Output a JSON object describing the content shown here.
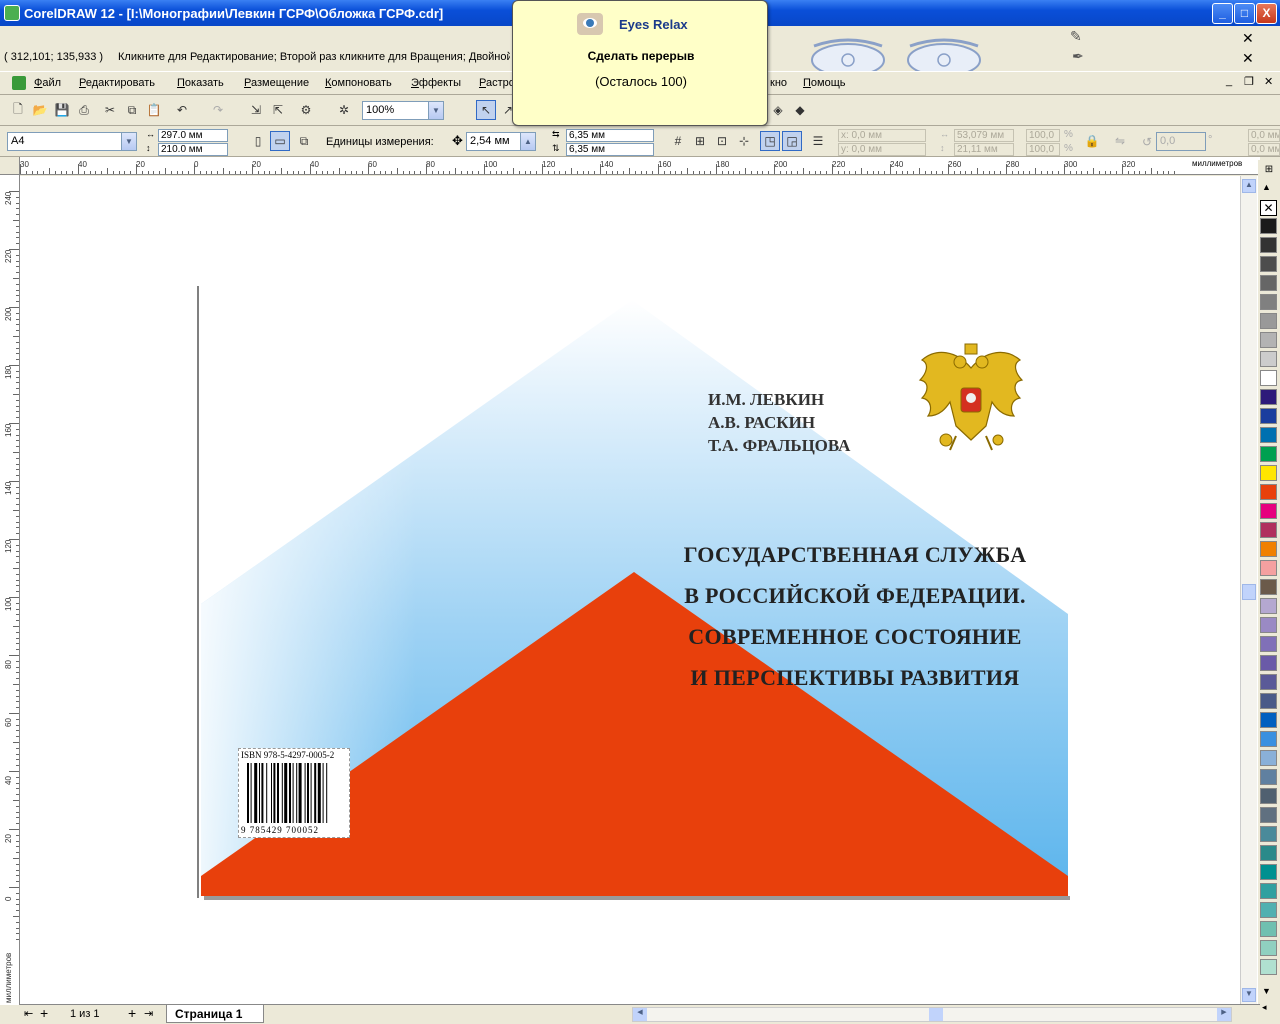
{
  "window": {
    "title": "CorelDRAW 12 - [I:\\Монографии\\Левкин ГСРФ\\Обложка ГСРФ.cdr]",
    "min_label": "_",
    "max_label": "□",
    "close_label": "X"
  },
  "status": {
    "coords": "( 312,101; 135,933 )",
    "hint": "Кликните для Редактирование; Второй раз кликните для Вращения; Двойной"
  },
  "menu": {
    "items": [
      {
        "u": "Ф",
        "rest": "айл"
      },
      {
        "u": "Р",
        "rest": "едактировать"
      },
      {
        "u": "П",
        "rest": "оказать"
      },
      {
        "u": "Р",
        "rest": "азмещение"
      },
      {
        "u": "К",
        "rest": "омпоновать"
      },
      {
        "u": "Э",
        "rest": "ффекты"
      },
      {
        "u": "Р",
        "rest": "астро"
      }
    ],
    "tail_items": [
      {
        "u": "",
        "rest": "кно"
      },
      {
        "u": "П",
        "rest": "омощь"
      }
    ]
  },
  "toolbar1": {
    "zoom": "100%"
  },
  "toolbar2": {
    "paper": "A4",
    "width": "297.0 мм",
    "height": "210.0 мм",
    "units_label": "Единицы измерения:",
    "nudge": "2,54 мм",
    "dup_x": "6,35 мм",
    "dup_y": "6,35 мм",
    "pos_x": "x: 0,0 мм",
    "pos_y": "y: 0,0 мм",
    "size_w": "53,079 мм",
    "size_h": "21,11 мм",
    "scale_w": "100,0",
    "scale_h": "100,0",
    "pct": "%",
    "angle": "0,0",
    "deg": "°",
    "right_x": "0,0 мм",
    "right_y": "0,0 мм"
  },
  "hruler": {
    "unit": "миллиметров",
    "ticks": [
      "30",
      "40",
      "20",
      "0",
      "20",
      "40",
      "60",
      "80",
      "100",
      "120",
      "140",
      "160",
      "180",
      "200",
      "220",
      "240",
      "260",
      "280",
      "300",
      "320"
    ]
  },
  "vruler": {
    "unit": "миллиметров",
    "ticks": [
      "240",
      "220",
      "200",
      "180",
      "160",
      "140",
      "120",
      "100",
      "80",
      "60",
      "40",
      "20",
      "0"
    ]
  },
  "cover": {
    "authors": [
      "И.М. ЛЕВКИН",
      "А.В. РАСКИН",
      "Т.А. ФРАЛЬЦОВА"
    ],
    "title_lines": [
      "ГОСУДАРСТВЕННАЯ СЛУЖБА",
      "В РОССИЙСКОЙ ФЕДЕРАЦИИ.",
      "СОВРЕМЕННОЕ СОСТОЯНИЕ",
      "И ПЕРСПЕКТИВЫ РАЗВИТИЯ"
    ],
    "isbn": "ISBN 978-5-4297-0005-2",
    "barcode_digits": "9 785429 700052",
    "colors": {
      "orange": "#E8400C",
      "blue": "#5AB4EC"
    }
  },
  "pages": {
    "counter": "1 из 1",
    "tab": "Страница 1"
  },
  "eyes_relax": {
    "app": "Eyes Relax",
    "message": "Сделать перерыв",
    "remaining": "(Осталось 100)"
  },
  "palette": [
    "#1a1a1a",
    "#333333",
    "#4d4d4d",
    "#666666",
    "#808080",
    "#999999",
    "#b3b3b3",
    "#cccccc",
    "#ffffff",
    "#2e1a7a",
    "#1a3d9e",
    "#0070b0",
    "#00a050",
    "#ffe600",
    "#e8400c",
    "#e6007e",
    "#b0305e",
    "#f08000",
    "#f4a0a0",
    "#6b5a4a",
    "#b4a8d0",
    "#9a8ac4",
    "#8070b8",
    "#6a5aa8",
    "#5a5a98",
    "#4a5a88",
    "#0060c0",
    "#3a90e0",
    "#8ab0d8",
    "#6080a0",
    "#506070",
    "#607080",
    "#4a8a9a",
    "#2a8a8a",
    "#009090",
    "#30a0a0",
    "#50b0b0",
    "#70c0b0",
    "#90d0c0",
    "#b0e0d0"
  ]
}
